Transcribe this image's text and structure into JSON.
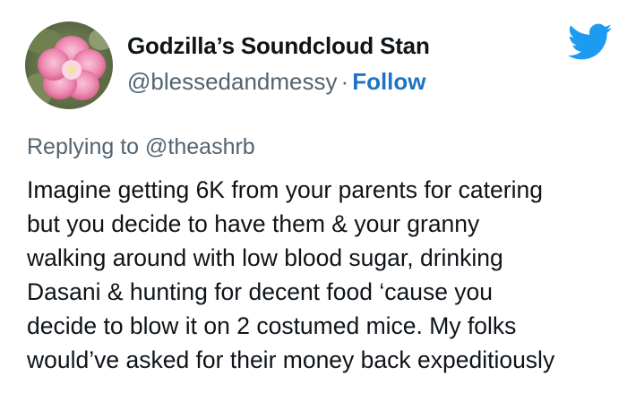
{
  "tweet": {
    "author": {
      "display_name": "Godzilla’s Soundcloud Stan",
      "handle": "@blessedandmessy",
      "separator": "·",
      "follow_label": "Follow",
      "avatar_icon": "pink-hibiscus-flower-avatar"
    },
    "brand_icon": "twitter-bird-icon",
    "replying_prefix": "Replying to",
    "replying_to": "@theashrb",
    "body_lines": [
      "Imagine getting 6K from your parents for catering",
      "but you decide to have them & your granny",
      "walking around with low blood sugar, drinking",
      "Dasani & hunting for decent food ‘cause you",
      "decide to blow it on 2 costumed mice. My folks",
      "would’ve asked for their money back expeditiously"
    ]
  },
  "colors": {
    "text": "#0f1419",
    "secondary": "#536471",
    "follow": "#1d74c4",
    "twitter_blue": "#1d9bf0"
  }
}
